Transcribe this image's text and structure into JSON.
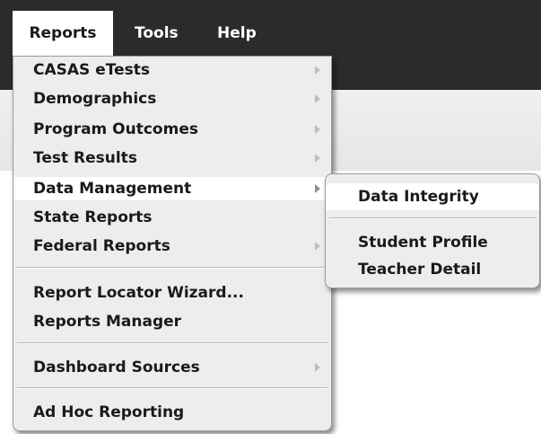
{
  "menubar": {
    "items": [
      {
        "label": "Reports"
      },
      {
        "label": "Tools"
      },
      {
        "label": "Help"
      }
    ]
  },
  "reports_menu": {
    "items": [
      {
        "label": "CASAS eTests",
        "submenu": true
      },
      {
        "label": "Demographics",
        "submenu": true
      },
      {
        "label": "Program Outcomes",
        "submenu": true
      },
      {
        "label": "Test Results",
        "submenu": true
      },
      {
        "label": "Data Management",
        "submenu": true,
        "highlighted": true
      },
      {
        "label": "State Reports",
        "submenu": false
      },
      {
        "label": "Federal Reports",
        "submenu": true
      },
      {
        "label": "Report Locator Wizard...",
        "submenu": false
      },
      {
        "label": "Reports Manager",
        "submenu": false
      },
      {
        "label": "Dashboard Sources",
        "submenu": true
      },
      {
        "label": "Ad Hoc Reporting",
        "submenu": false
      }
    ]
  },
  "data_management_submenu": {
    "items": [
      {
        "label": "Data Integrity",
        "highlighted": true
      },
      {
        "label": "Student Profile"
      },
      {
        "label": "Teacher Detail"
      }
    ]
  },
  "colors": {
    "menubar_bg": "#2b2b2b",
    "menu_bg": "#ededed",
    "highlight_bg": "#ffffff",
    "text": "#1a1a1a"
  }
}
